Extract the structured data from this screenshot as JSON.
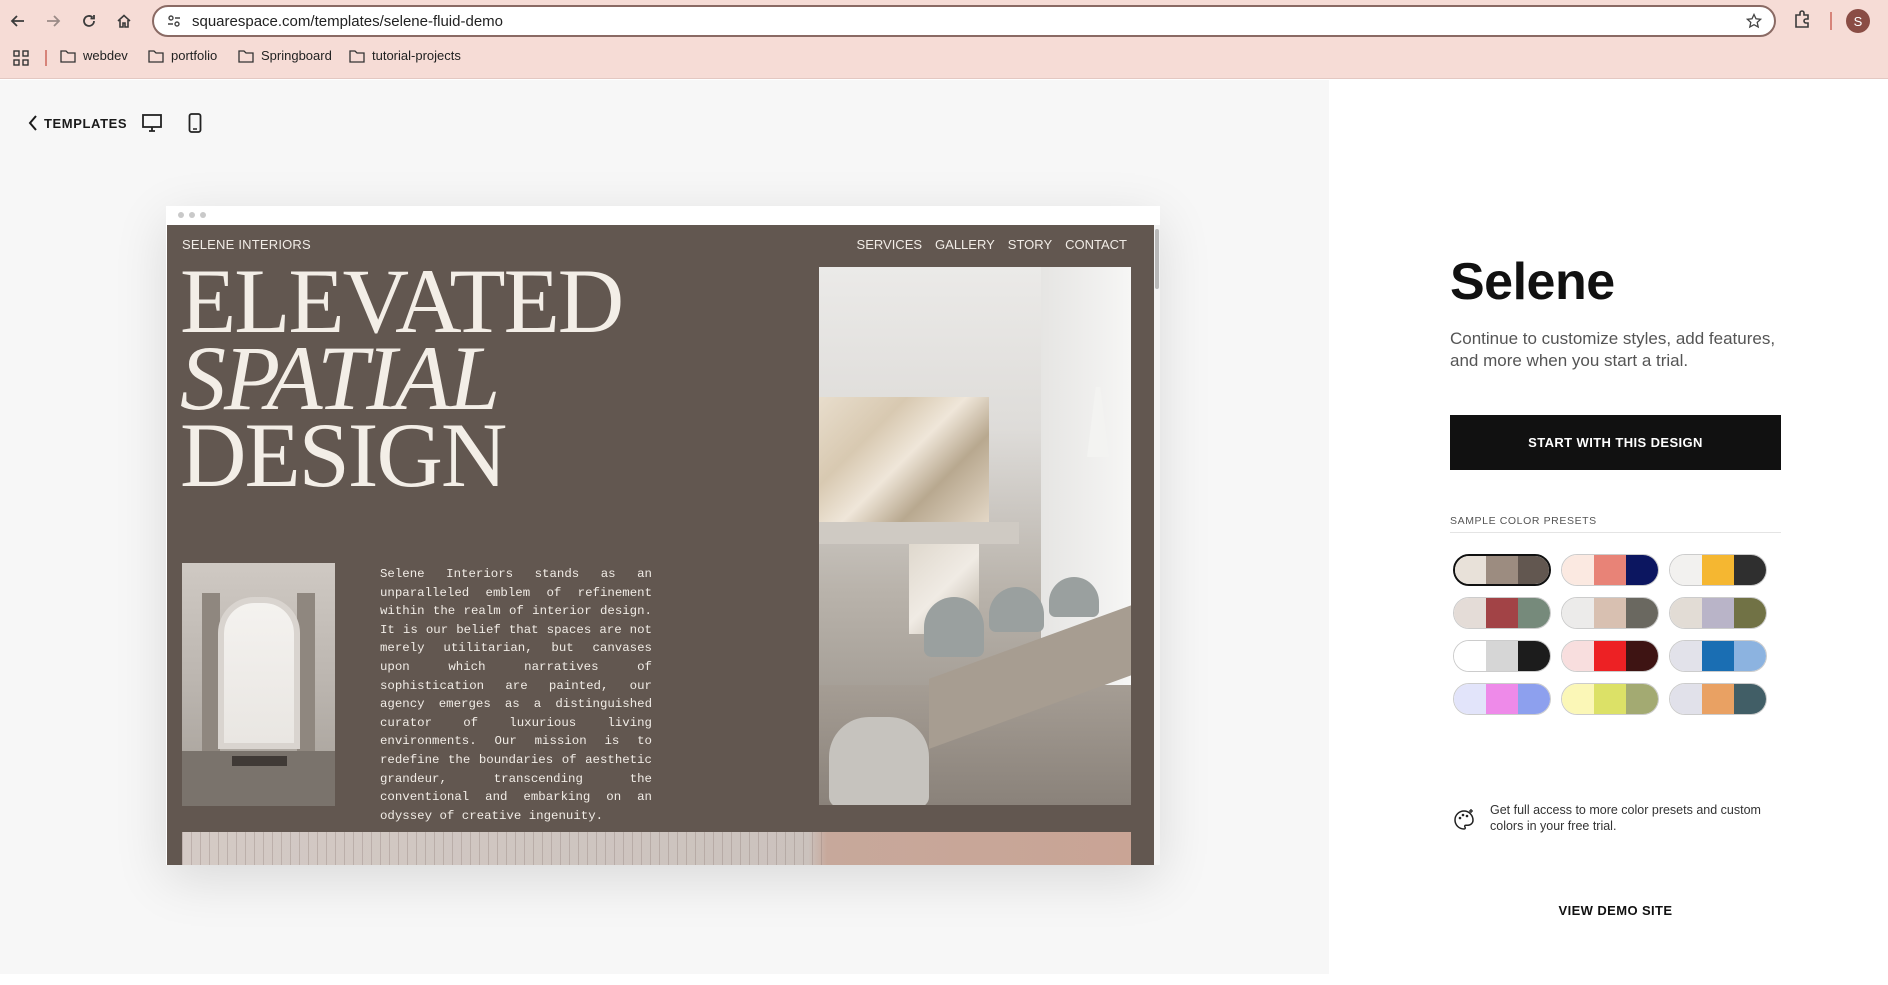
{
  "browser": {
    "url": "squarespace.com/templates/selene-fluid-demo",
    "profile_initial": "S",
    "bookmarks": [
      {
        "label": "webdev"
      },
      {
        "label": "portfolio"
      },
      {
        "label": "Springboard"
      },
      {
        "label": "tutorial-projects"
      }
    ]
  },
  "toolbar": {
    "back_label": "TEMPLATES"
  },
  "site": {
    "brand": "SELENE INTERIORS",
    "nav": [
      "SERVICES",
      "GALLERY",
      "STORY",
      "CONTACT"
    ],
    "headline_line1": "ELEVATED",
    "headline_line2": "SPATIAL",
    "headline_line3": "DESIGN",
    "paragraph": "Selene Interiors stands as an unparalleled emblem of refinement within the realm of interior design. It is our belief that spaces are not merely utilitarian, but canvases upon which narratives of sophistication are painted, our agency emerges as a distinguished curator of luxurious living environments. Our mission is to redefine the boundaries of aesthetic grandeur, transcending the conventional and embarking on an odyssey of creative ingenuity."
  },
  "panel": {
    "title": "Selene",
    "description": "Continue to customize styles, add features, and more when you start a trial.",
    "cta_label": "START WITH THIS DESIGN",
    "presets_label": "SAMPLE COLOR PRESETS",
    "presets": [
      {
        "colors": [
          "#e8e1d9",
          "#9c8c80",
          "#625750"
        ],
        "selected": true
      },
      {
        "colors": [
          "#fbe9e1",
          "#e88377",
          "#0c1660"
        ],
        "selected": false
      },
      {
        "colors": [
          "#f2f1ef",
          "#f5b731",
          "#2f2f2f"
        ],
        "selected": false
      },
      {
        "colors": [
          "#e4dcd7",
          "#a24346",
          "#768a7b"
        ],
        "selected": false
      },
      {
        "colors": [
          "#ecebea",
          "#d8c0b1",
          "#6a6860"
        ],
        "selected": false
      },
      {
        "colors": [
          "#e2dcd5",
          "#b9b4c8",
          "#717245"
        ],
        "selected": false
      },
      {
        "colors": [
          "#ffffff",
          "#d6d6d6",
          "#1c1c1c"
        ],
        "selected": false
      },
      {
        "colors": [
          "#f8dede",
          "#ed2124",
          "#3e1413"
        ],
        "selected": false
      },
      {
        "colors": [
          "#e2e2ea",
          "#1a6eb3",
          "#8cb3e0"
        ],
        "selected": false
      },
      {
        "colors": [
          "#e2e4fa",
          "#ee8ae9",
          "#8da0ee"
        ],
        "selected": false
      },
      {
        "colors": [
          "#fbf7b7",
          "#dce167",
          "#a3aa72"
        ],
        "selected": false
      },
      {
        "colors": [
          "#e1e1ea",
          "#e9a163",
          "#415e66"
        ],
        "selected": false
      }
    ],
    "promo_text": "Get full access to more color presets and custom colors in your free trial.",
    "demo_link": "VIEW DEMO SITE"
  }
}
